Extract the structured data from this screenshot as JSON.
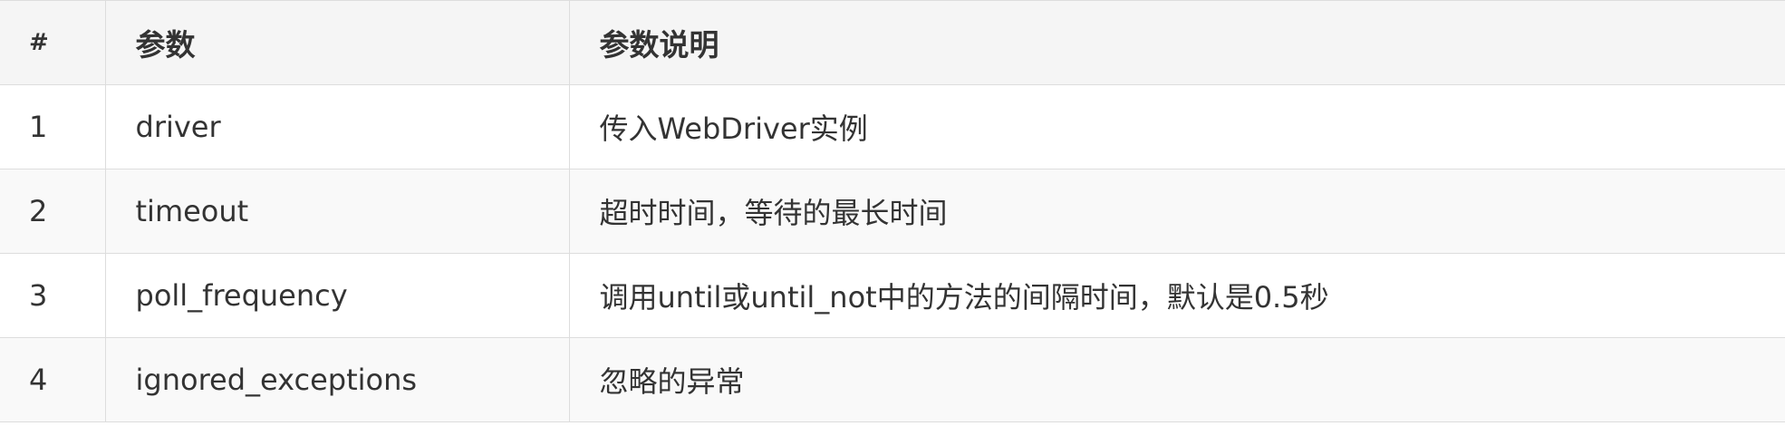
{
  "table": {
    "headers": [
      "#",
      "参数",
      "参数说明"
    ],
    "rows": [
      [
        "1",
        "driver",
        "传入WebDriver实例"
      ],
      [
        "2",
        "timeout",
        "超时时间，等待的最长时间"
      ],
      [
        "3",
        "poll_frequency",
        "调用until或until_not中的方法的间隔时间，默认是0.5秒"
      ],
      [
        "4",
        "ignored_exceptions",
        "忽略的异常"
      ]
    ]
  }
}
